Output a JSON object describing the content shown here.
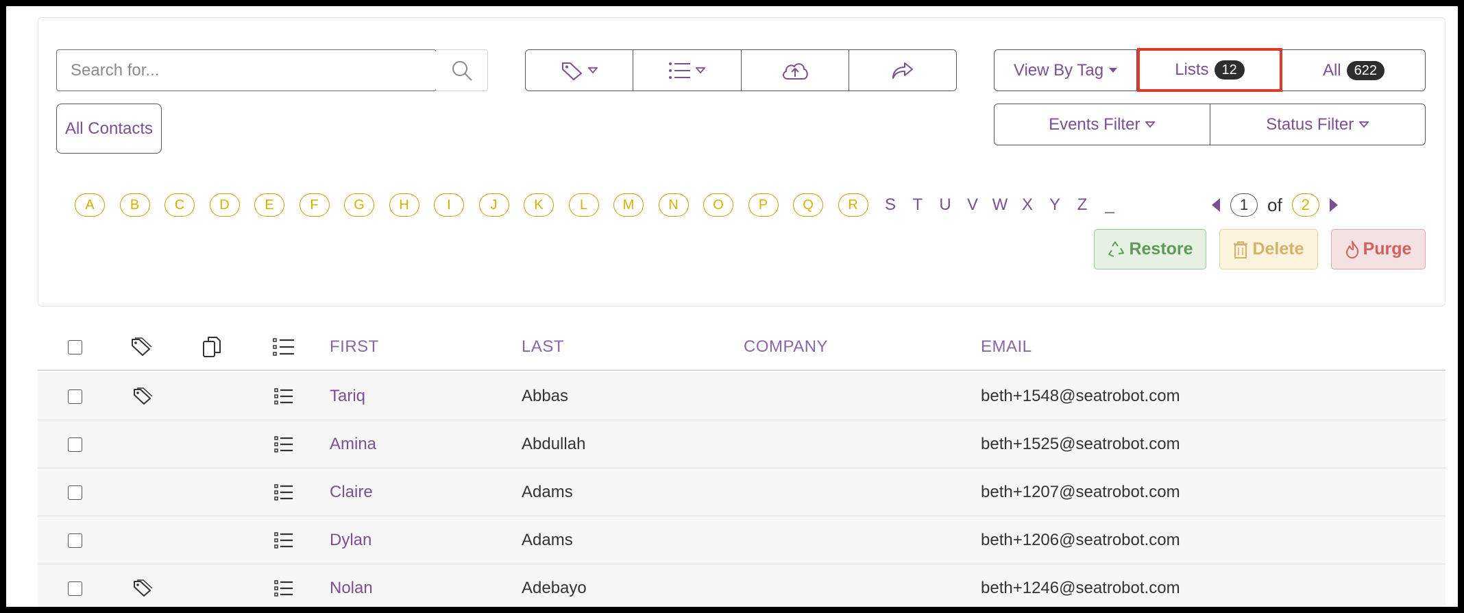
{
  "search": {
    "placeholder": "Search for..."
  },
  "toolbar": {
    "tag_icon": "tag-icon",
    "list_icon": "list-icon",
    "upload_icon": "cloud-upload-icon",
    "share_icon": "share-arrow-icon"
  },
  "view": {
    "by_tag_label": "View By Tag",
    "lists_label": "Lists",
    "lists_count": "12",
    "all_label": "All",
    "all_count": "622"
  },
  "filters": {
    "events_label": "Events Filter",
    "status_label": "Status Filter"
  },
  "all_contacts_label": "All Contacts",
  "letters_active": [
    "A",
    "B",
    "C",
    "D",
    "E",
    "F",
    "G",
    "H",
    "I",
    "J",
    "K",
    "L",
    "M",
    "N",
    "O",
    "P",
    "Q",
    "R"
  ],
  "letters_plain": [
    "S",
    "T",
    "U",
    "V",
    "W",
    "X",
    "Y",
    "Z",
    "_"
  ],
  "pager": {
    "current": "1",
    "of_label": "of",
    "total": "2"
  },
  "actions": {
    "restore_label": "Restore",
    "delete_label": "Delete",
    "purge_label": "Purge"
  },
  "table": {
    "headers": {
      "first": "FIRST",
      "last": "LAST",
      "company": "COMPANY",
      "email": "EMAIL"
    },
    "rows": [
      {
        "has_tag": true,
        "first": "Tariq",
        "last": "Abbas",
        "company": "",
        "email": "beth+1548@seatrobot.com"
      },
      {
        "has_tag": false,
        "first": "Amina",
        "last": "Abdullah",
        "company": "",
        "email": "beth+1525@seatrobot.com"
      },
      {
        "has_tag": false,
        "first": "Claire",
        "last": "Adams",
        "company": "",
        "email": "beth+1207@seatrobot.com"
      },
      {
        "has_tag": false,
        "first": "Dylan",
        "last": "Adams",
        "company": "",
        "email": "beth+1206@seatrobot.com"
      },
      {
        "has_tag": true,
        "first": "Nolan",
        "last": "Adebayo",
        "company": "",
        "email": "beth+1246@seatrobot.com"
      }
    ]
  },
  "colors": {
    "accent": "#7b4f94",
    "letter_gold": "#d8b000",
    "highlight": "#e03a2c"
  }
}
